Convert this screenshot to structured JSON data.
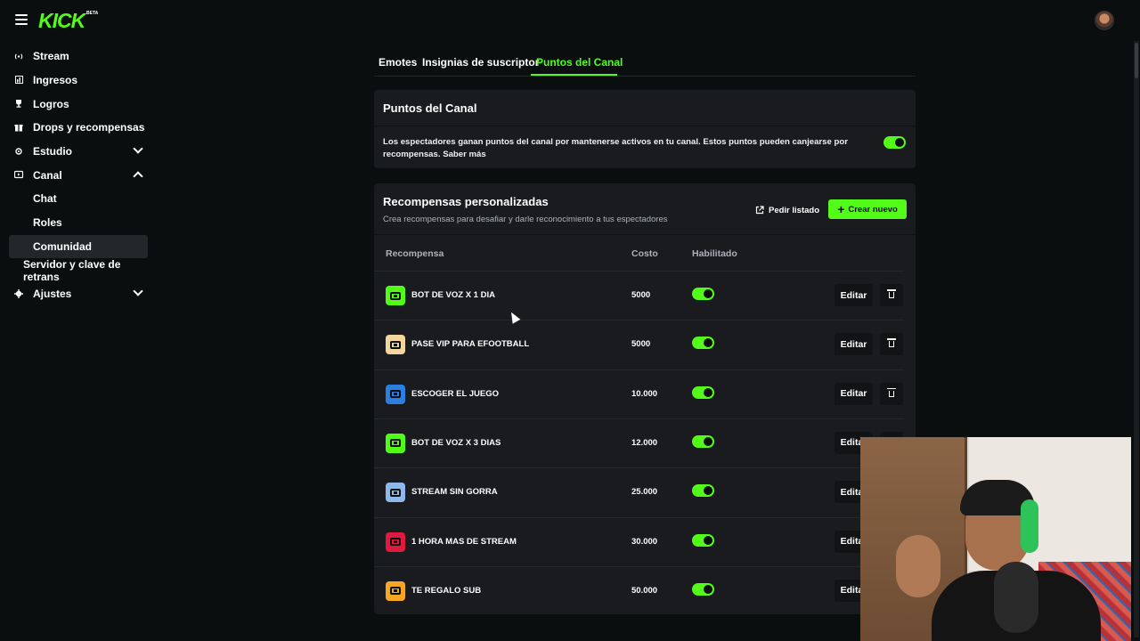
{
  "app": {
    "logo": "KICK",
    "logo_badge": "BETA"
  },
  "sidebar": {
    "items": [
      {
        "label": "Stream",
        "icon": "broadcast-icon"
      },
      {
        "label": "Ingresos",
        "icon": "chart-icon"
      },
      {
        "label": "Logros",
        "icon": "trophy-icon"
      },
      {
        "label": "Drops y recompensas",
        "icon": "gift-icon"
      },
      {
        "label": "Estudio",
        "icon": "studio-icon",
        "expanded": false
      },
      {
        "label": "Canal",
        "icon": "channel-icon",
        "expanded": true
      },
      {
        "label": "Chat"
      },
      {
        "label": "Roles"
      },
      {
        "label": "Comunidad",
        "active": true
      },
      {
        "label": "Servidor y clave de retrans"
      },
      {
        "label": "Ajustes",
        "icon": "gear-icon",
        "expanded": false
      }
    ]
  },
  "tabs": [
    {
      "label": "Emotes"
    },
    {
      "label": "Insignias de suscriptor"
    },
    {
      "label": "Puntos del Canal",
      "active": true
    }
  ],
  "channel_points": {
    "title": "Puntos del Canal",
    "description": "Los espectadores ganan puntos del canal por mantenerse activos en tu canal. Estos puntos pueden canjearse por recompensas. Saber más",
    "enabled": true
  },
  "rewards": {
    "title": "Recompensas personalizadas",
    "subtitle": "Crea recompensas para desafiar y darle reconocimiento a tus espectadores",
    "list_button": "Pedir listado",
    "create_button": "Crear nuevo",
    "headers": {
      "reward": "Recompensa",
      "cost": "Costo",
      "enabled": "Habilitado"
    },
    "edit_label": "Editar",
    "items": [
      {
        "name": "BOT DE VOZ X 1 DIA",
        "cost": "5000",
        "color": "#53fc18",
        "enabled": true
      },
      {
        "name": "PASE VIP PARA EFOOTBALL",
        "cost": "5000",
        "color": "#f5d59e",
        "enabled": true
      },
      {
        "name": "ESCOGER EL JUEGO",
        "cost": "10.000",
        "color": "#2a7fe0",
        "enabled": true
      },
      {
        "name": "BOT DE VOZ X 3 DIAS",
        "cost": "12.000",
        "color": "#53fc18",
        "enabled": true
      },
      {
        "name": "STREAM SIN GORRA",
        "cost": "25.000",
        "color": "#8fb8ea",
        "enabled": true
      },
      {
        "name": "1 HORA MAS DE STREAM",
        "cost": "30.000",
        "color": "#e0193f",
        "enabled": true
      },
      {
        "name": "TE REGALO SUB",
        "cost": "50.000",
        "color": "#f5a623",
        "enabled": true
      }
    ]
  },
  "colors": {
    "accent": "#53fc18",
    "background": "#0b0e0f",
    "panel": "#191b1f"
  }
}
